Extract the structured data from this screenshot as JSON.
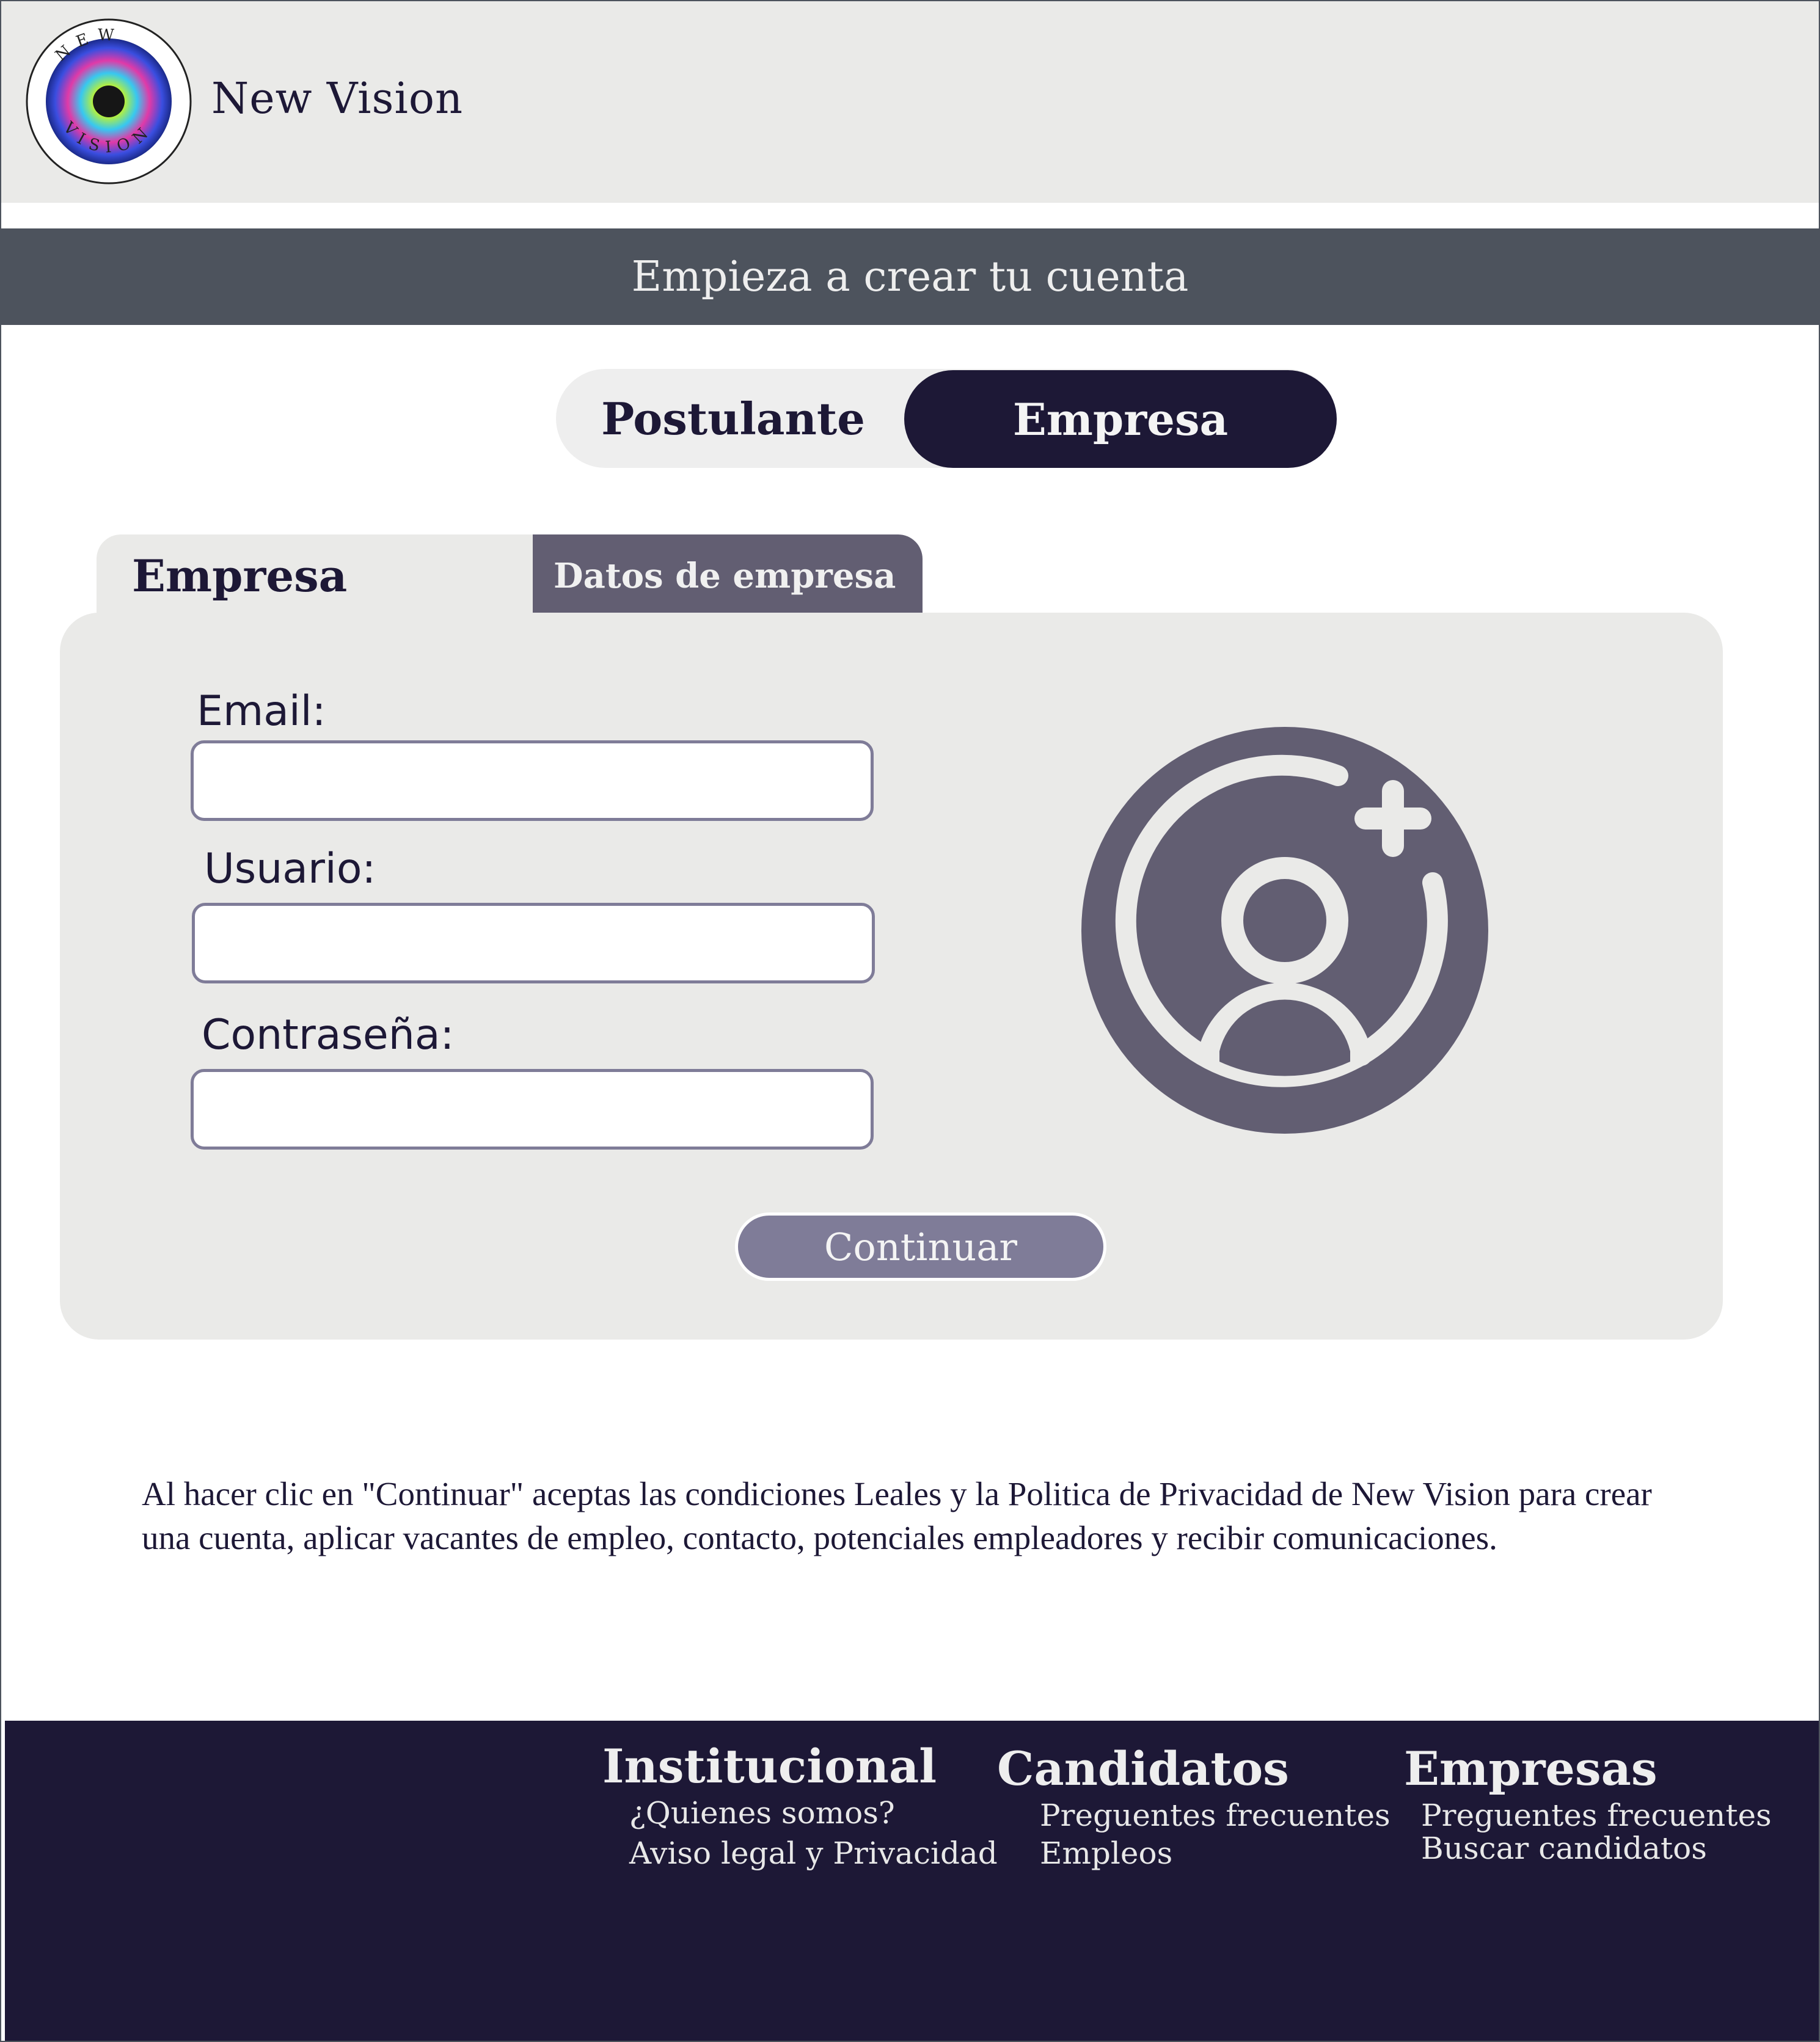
{
  "brand": {
    "name": "New Vision",
    "logo_ring_text": "NEW VISION"
  },
  "banner": {
    "title": "Empieza a crear tu cuenta"
  },
  "role_toggle": {
    "options": [
      "Postulante",
      "Empresa"
    ],
    "selected": "Empresa"
  },
  "tabs": {
    "active": "Empresa",
    "next": "Datos de empresa"
  },
  "form": {
    "email_label": "Email:",
    "email_value": "",
    "usuario_label": "Usuario:",
    "usuario_value": "",
    "password_label": "Contraseña:",
    "password_value": "",
    "continue_label": "Continuar"
  },
  "avatar": {
    "icon": "add-user-icon"
  },
  "legal": {
    "text": "Al hacer clic en \"Continuar\" aceptas las condiciones Leales y la Politica de Privacidad de New Vision para crear una cuenta, aplicar vacantes de empleo, contacto, potenciales empleadores y recibir comunicaciones."
  },
  "footer": {
    "institucional": {
      "heading": "Institucional",
      "links": [
        "¿Quienes somos?",
        "Aviso legal y Privacidad"
      ]
    },
    "candidatos": {
      "heading": "Candidatos",
      "links": [
        "Preguentes frecuentes",
        "Empleos"
      ]
    },
    "empresas": {
      "heading": "Empresas",
      "links": [
        "Preguentes frecuentes",
        "Buscar candidatos"
      ]
    }
  },
  "colors": {
    "navy": "#1d1836",
    "slate": "#4d535d",
    "muted_purple": "#625e72",
    "button": "#7f7c98",
    "panel": "#eaeae8"
  }
}
